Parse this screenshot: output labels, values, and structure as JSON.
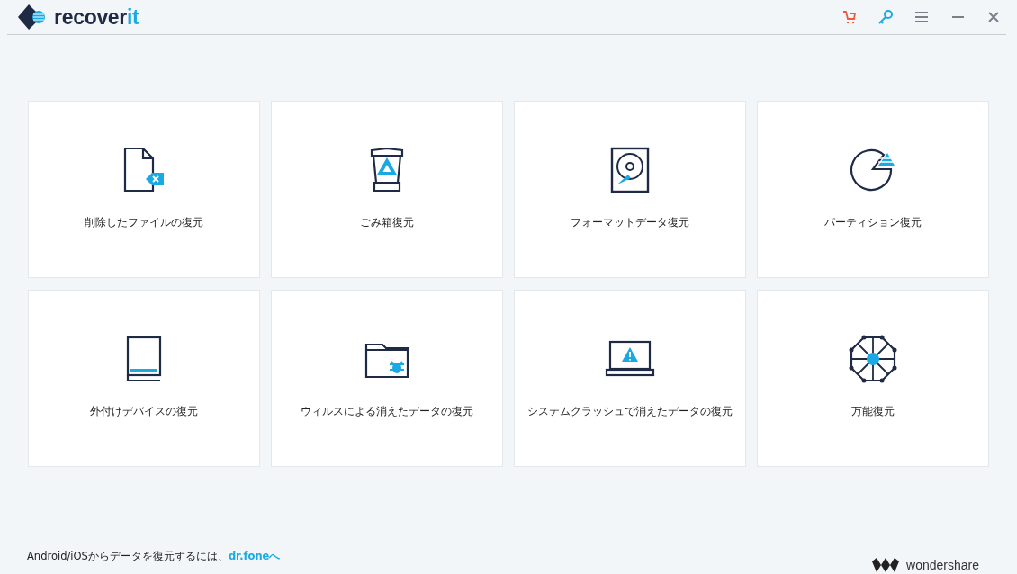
{
  "header": {
    "logo_main": "recover",
    "logo_accent": "it"
  },
  "modes": [
    {
      "kind": "deleted",
      "label": "削除したファイルの復元"
    },
    {
      "kind": "trash",
      "label": "ごみ箱復元"
    },
    {
      "kind": "format",
      "label": "フォーマットデータ復元"
    },
    {
      "kind": "partition",
      "label": "パーティション復元"
    },
    {
      "kind": "external",
      "label": "外付けデバイスの復元"
    },
    {
      "kind": "virus",
      "label": "ウィルスによる消えたデータの復元"
    },
    {
      "kind": "crash",
      "label": "システムクラッシュで消えたデータの復元"
    },
    {
      "kind": "all",
      "label": "万能復元"
    }
  ],
  "footer": {
    "text": "Android/iOSからデータを復元するには、",
    "link": "dr.foneへ",
    "brand": "wondershare"
  }
}
